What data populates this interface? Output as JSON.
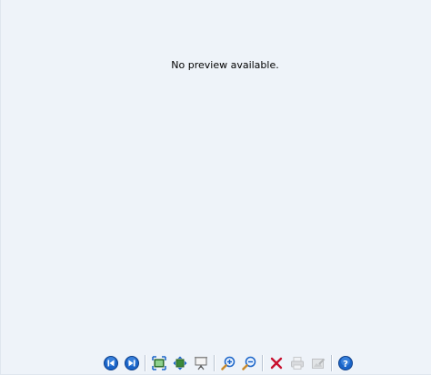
{
  "preview": {
    "message": "No preview available."
  },
  "toolbar": {
    "buttons": [
      {
        "icon": "previous-icon",
        "enabled": true
      },
      {
        "icon": "next-icon",
        "enabled": true
      },
      {
        "icon": "best-fit-icon",
        "enabled": true
      },
      {
        "icon": "actual-size-icon",
        "enabled": true
      },
      {
        "icon": "slideshow-icon",
        "enabled": true
      },
      {
        "icon": "zoom-in-icon",
        "enabled": true
      },
      {
        "icon": "zoom-out-icon",
        "enabled": true
      },
      {
        "icon": "delete-icon",
        "enabled": true
      },
      {
        "icon": "print-icon",
        "enabled": false
      },
      {
        "icon": "edit-icon",
        "enabled": false
      },
      {
        "icon": "help-icon",
        "enabled": true
      }
    ]
  },
  "colors": {
    "background": "#eef3f9",
    "nav_blue": "#1a64c8",
    "delete_red": "#c8102e"
  }
}
